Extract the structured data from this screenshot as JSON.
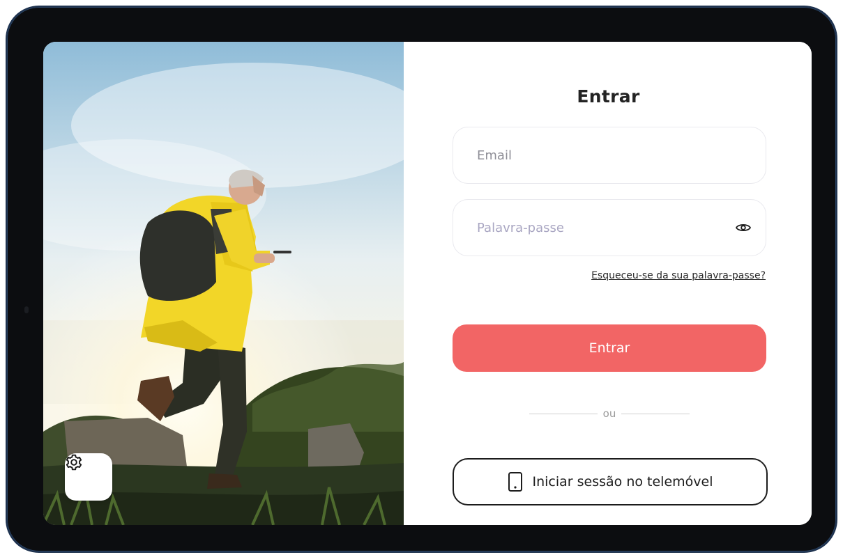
{
  "login": {
    "title": "Entrar",
    "email_placeholder": "Email",
    "password_placeholder": "Palavra-passe",
    "forgot_link": "Esqueceu-se da sua palavra-passe?",
    "submit_label": "Entrar",
    "divider_text": "ou",
    "phone_login_label": "Iniciar sessão no telemóvel"
  },
  "icons": {
    "settings": "gear-icon",
    "show_password": "eye-icon",
    "phone": "mobile-phone-icon"
  },
  "colors": {
    "primary_button": "#f26565",
    "device_frame": "#0c0d10",
    "text": "#232323"
  }
}
